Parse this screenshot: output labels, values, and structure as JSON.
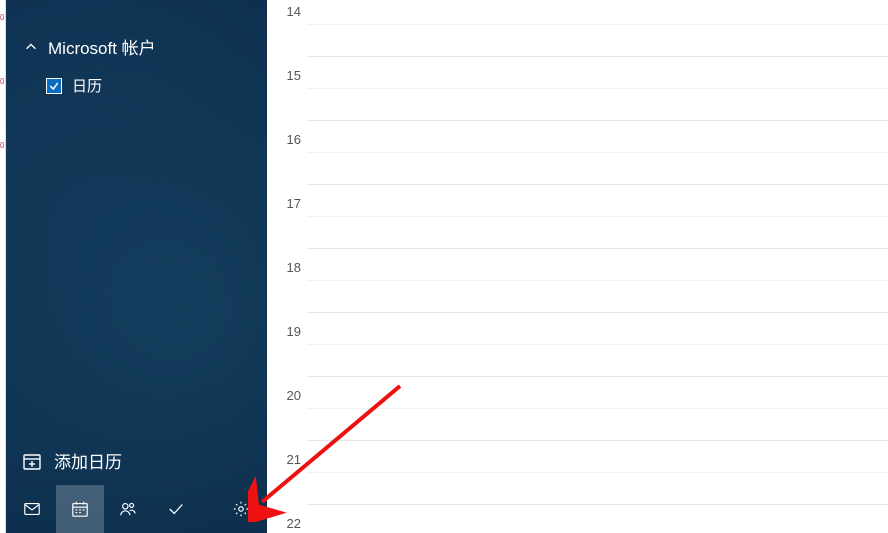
{
  "sidebar": {
    "account_label": "Microsoft 帐户",
    "calendar_item_label": "日历",
    "add_calendar_label": "添加日历"
  },
  "nav": {
    "mail": "mail-icon",
    "calendar": "calendar-icon",
    "people": "people-icon",
    "todo": "todo-icon",
    "settings": "settings-icon"
  },
  "hours": [
    "14",
    "15",
    "16",
    "17",
    "18",
    "19",
    "20",
    "21",
    "22"
  ],
  "colors": {
    "accent": "#0c6dbf"
  }
}
